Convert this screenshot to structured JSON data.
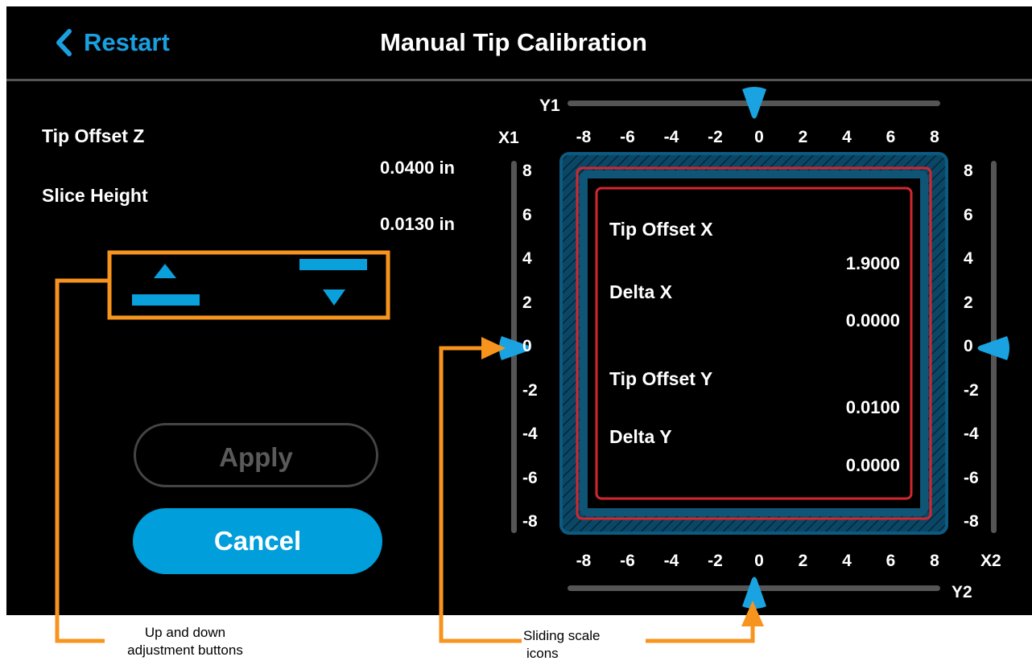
{
  "header": {
    "back_label": "Restart",
    "title": "Manual Tip Calibration"
  },
  "left": {
    "tip_offset_z_label": "Tip Offset Z",
    "tip_offset_z_value": "0.0400 in",
    "slice_height_label": "Slice Height",
    "slice_height_value": "0.0130 in",
    "apply_label": "Apply",
    "cancel_label": "Cancel"
  },
  "panel": {
    "tip_offset_x_label": "Tip Offset X",
    "tip_offset_x_value": "1.9000",
    "delta_x_label": "Delta X",
    "delta_x_value": "0.0000",
    "tip_offset_y_label": "Tip Offset Y",
    "tip_offset_y_value": "0.0100",
    "delta_y_label": "Delta Y",
    "delta_y_value": "0.0000"
  },
  "scales": {
    "y1_label": "Y1",
    "y2_label": "Y2",
    "x1_label": "X1",
    "x2_label": "X2",
    "ticks_h": [
      "-8",
      "-6",
      "-4",
      "-2",
      "0",
      "2",
      "4",
      "6",
      "8"
    ],
    "ticks_v": [
      "8",
      "6",
      "4",
      "2",
      "0",
      "-2",
      "-4",
      "-6",
      "-8"
    ],
    "y1_value": 0,
    "y2_value": 0,
    "x1_value": 0,
    "x2_value": 0
  },
  "annotations": {
    "buttons_note": "Up and down adjustment buttons",
    "buttons_note_line1": "Up and down",
    "buttons_note_line2": "adjustment buttons",
    "scale_note_line1": "Sliding scale",
    "scale_note_line2": "icons"
  },
  "colors": {
    "accent": "#009edb",
    "frame_blue": "#0e4f6f",
    "frame_red": "#d3262f",
    "annotation_orange": "#f7941d"
  },
  "icons": {
    "back": "chevron-left-icon",
    "up": "up-arrow-bar-icon",
    "down": "down-arrow-bar-icon",
    "slider": "teardrop-pointer-icon"
  }
}
